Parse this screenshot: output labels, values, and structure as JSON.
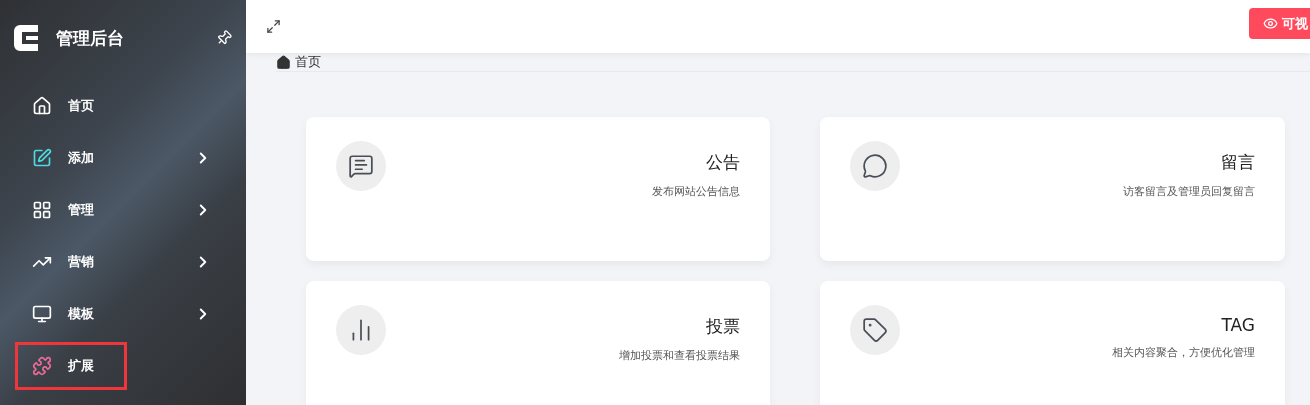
{
  "sidebar": {
    "title": "管理后台",
    "items": [
      {
        "label": "首页",
        "has_submenu": false,
        "highlighted": false
      },
      {
        "label": "添加",
        "has_submenu": true,
        "highlighted": false
      },
      {
        "label": "管理",
        "has_submenu": true,
        "highlighted": false
      },
      {
        "label": "营销",
        "has_submenu": true,
        "highlighted": false
      },
      {
        "label": "模板",
        "has_submenu": true,
        "highlighted": false
      },
      {
        "label": "扩展",
        "has_submenu": false,
        "highlighted": true
      }
    ]
  },
  "topbar": {
    "button": "可视"
  },
  "breadcrumb": "首页",
  "cards": [
    {
      "title": "公告",
      "description": "发布网站公告信息"
    },
    {
      "title": "留言",
      "description": "访客留言及管理员回复留言"
    },
    {
      "title": "投票",
      "description": "增加投票和查看投票结果"
    },
    {
      "title": "TAG",
      "description": "相关内容聚合，方便优化管理"
    }
  ]
}
